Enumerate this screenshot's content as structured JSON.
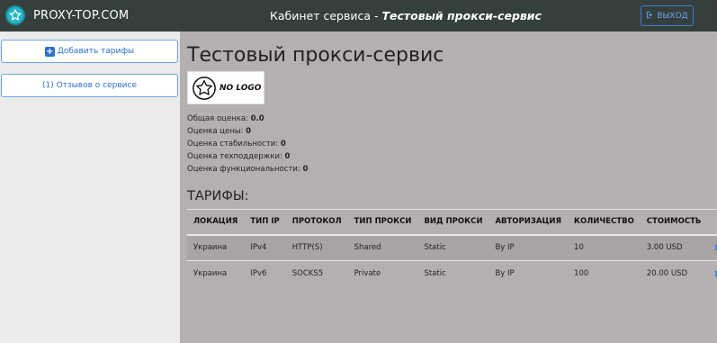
{
  "header": {
    "brand": "PROXY-TOP.COM",
    "title_prefix": "Кабинет сервиса - ",
    "title_service": "Тестовый прокси-сервис",
    "logout_label": "ВЫХОД"
  },
  "sidebar": {
    "add_tariffs_label": "Добавить тарифы",
    "reviews_label": "(1) Отзывов о сервисе"
  },
  "main": {
    "service_title": "Тестовый прокси-сервис",
    "logo_text": "NO LOGO",
    "ratings": [
      {
        "label": "Общая оценка: ",
        "value": "0.0"
      },
      {
        "label": "Оценка цены: ",
        "value": "0"
      },
      {
        "label": "Оценка стабильности: ",
        "value": "0"
      },
      {
        "label": "Оценка техподдержки: ",
        "value": "0"
      },
      {
        "label": "Оценка функциональности: ",
        "value": "0"
      }
    ],
    "tariffs_title": "ТАРИФЫ:",
    "table": {
      "headers": [
        "ЛОКАЦИЯ",
        "ТИП IP",
        "ПРОТОКОЛ",
        "ТИП ПРОКСИ",
        "ВИД ПРОКСИ",
        "АВТОРИЗАЦИЯ",
        "КОЛИЧЕСТВО",
        "СТОИМОСТЬ"
      ],
      "rows": [
        [
          "Украина",
          "IPv4",
          "HTTP(S)",
          "Shared",
          "Static",
          "By IP",
          "10",
          "3.00 USD"
        ],
        [
          "Украина",
          "IPv6",
          "SOCKS5",
          "Private",
          "Static",
          "By IP",
          "100",
          "20.00 USD"
        ]
      ]
    }
  },
  "colors": {
    "topbar": "#353f3d",
    "accent": "#2f6fc7",
    "page_bg": "#b5b0b0",
    "sidebar_bg": "#ebebeb"
  }
}
